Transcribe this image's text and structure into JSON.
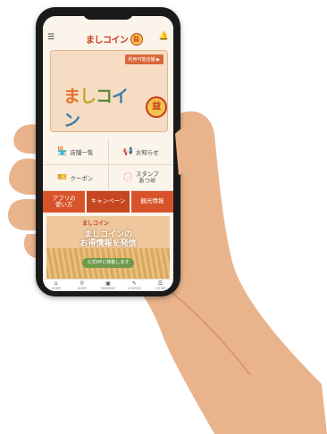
{
  "app": {
    "logo_text": "ましコイン",
    "coin_glyph": "益"
  },
  "hero": {
    "tag": "利用可能店舗",
    "logo_parts": [
      "ま",
      "し",
      "コ",
      "イン"
    ]
  },
  "menu": [
    {
      "icon": "🏪",
      "label": "店舗一覧"
    },
    {
      "icon": "📢",
      "label": "お知らせ"
    },
    {
      "icon": "🎫",
      "label": "クーポン"
    },
    {
      "icon": "💮",
      "label": "スタンプ\nあつめ"
    }
  ],
  "actions": [
    {
      "label": "アプリの\n使い方"
    },
    {
      "label": "キャンペーン"
    },
    {
      "label": "観光情報"
    }
  ],
  "banner": {
    "top": "ましコイン",
    "title": "ましコインの\nお得情報を発信",
    "pill": "公式HPに移動します"
  },
  "tabs": [
    {
      "icon": "⌂",
      "label": "HOME"
    },
    {
      "icon": "⚲",
      "label": "SHOP"
    },
    {
      "icon": "▣",
      "label": "PAYMENT"
    },
    {
      "icon": "✎",
      "label": "COUPON"
    },
    {
      "icon": "☰",
      "label": "OTHER"
    }
  ],
  "colors": {
    "accent": "#d9532a",
    "brand_red": "#c83a1e",
    "background": "#fbf4ea"
  }
}
